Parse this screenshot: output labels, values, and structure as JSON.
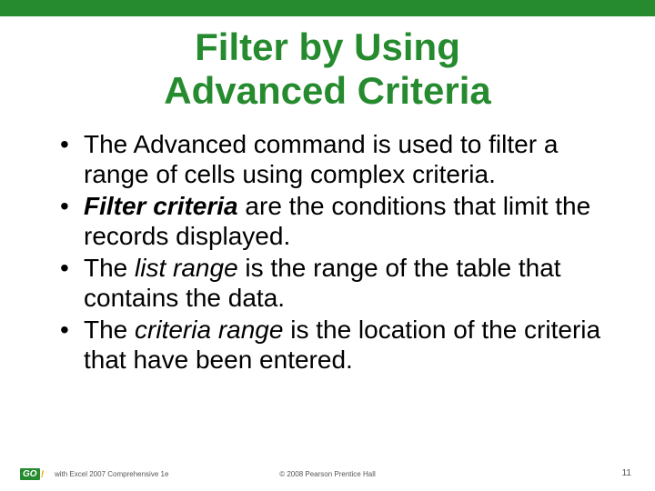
{
  "title_line1": "Filter by Using",
  "title_line2": "Advanced Criteria",
  "bullets": [
    {
      "pre": "The Advanced command is used to filter a range of cells using complex criteria."
    },
    {
      "term": "Filter criteria",
      "rest": " are the conditions that limit the records displayed."
    },
    {
      "pre": "The ",
      "term": "list range",
      "rest": " is the range of the table that contains the data."
    },
    {
      "pre": "The ",
      "term": "criteria range",
      "rest": " is the location of the criteria that have been entered."
    }
  ],
  "footer": {
    "logo_text": "GO",
    "logo_excl": "!",
    "left": "with Excel 2007 Comprehensive 1e",
    "center": "© 2008 Pearson Prentice Hall",
    "page": "11"
  }
}
